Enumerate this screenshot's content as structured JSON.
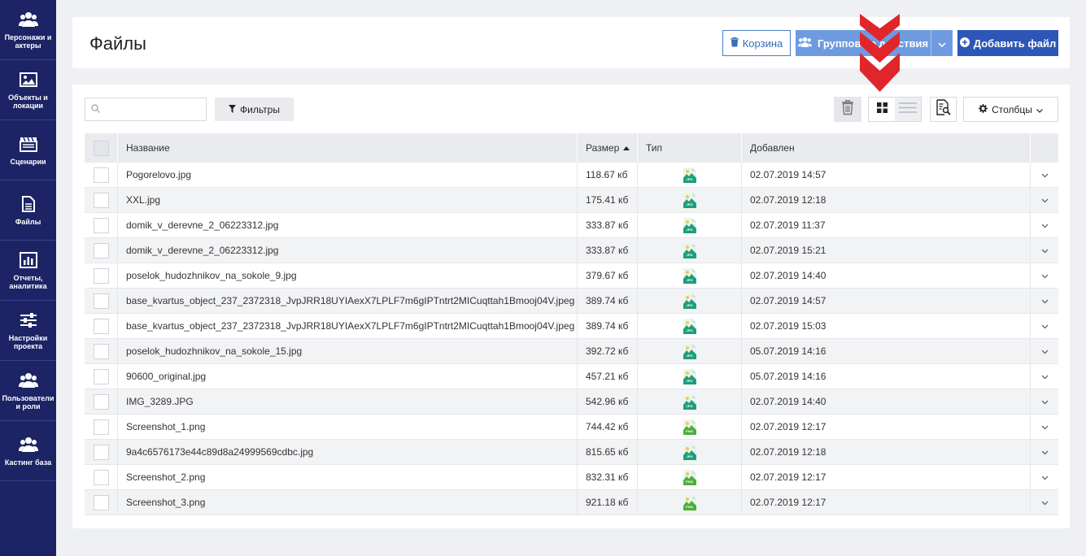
{
  "sidebar": {
    "items": [
      {
        "label": "Персонажи и актеры",
        "icon": "users-icon"
      },
      {
        "label": "Объекты и локации",
        "icon": "image-icon"
      },
      {
        "label": "Сценарии",
        "icon": "clapperboard-icon"
      },
      {
        "label": "Файлы",
        "icon": "file-icon"
      },
      {
        "label": "Отчеты, аналитика",
        "icon": "bar-chart-icon"
      },
      {
        "label": "Настройки проекта",
        "icon": "sliders-icon"
      },
      {
        "label": "Пользователи и роли",
        "icon": "users-icon"
      },
      {
        "label": "Кастинг база",
        "icon": "users-icon"
      }
    ]
  },
  "header": {
    "title": "Файлы",
    "trash_label": "Корзина",
    "group_label": "Групповые действия",
    "add_label": "Добавить файл"
  },
  "toolbar": {
    "search_placeholder": "",
    "filter_label": "Фильтры",
    "columns_label": "Столбцы"
  },
  "table": {
    "columns": {
      "name": "Название",
      "size": "Размер",
      "type": "Тип",
      "added": "Добавлен"
    },
    "rows": [
      {
        "name": "Pogorelovo.jpg",
        "size": "118.67 кб",
        "type": "JPG",
        "added": "02.07.2019 14:57"
      },
      {
        "name": "XXL.jpg",
        "size": "175.41 кб",
        "type": "JPG",
        "added": "02.07.2019 12:18"
      },
      {
        "name": "domik_v_derevne_2_06223312.jpg",
        "size": "333.87 кб",
        "type": "JPG",
        "added": "02.07.2019 11:37"
      },
      {
        "name": "domik_v_derevne_2_06223312.jpg",
        "size": "333.87 кб",
        "type": "JPG",
        "added": "02.07.2019 15:21"
      },
      {
        "name": "poselok_hudozhnikov_na_sokole_9.jpg",
        "size": "379.67 кб",
        "type": "JPG",
        "added": "02.07.2019 14:40"
      },
      {
        "name": "base_kvartus_object_237_2372318_JvpJRR18UYIAexX7LPLF7m6gIPTntrt2MICuqttah1Bmooj04V.jpeg",
        "size": "389.74 кб",
        "type": "JPG",
        "added": "02.07.2019 14:57"
      },
      {
        "name": "base_kvartus_object_237_2372318_JvpJRR18UYIAexX7LPLF7m6gIPTntrt2MICuqttah1Bmooj04V.jpeg",
        "size": "389.74 кб",
        "type": "JPG",
        "added": "02.07.2019 15:03"
      },
      {
        "name": "poselok_hudozhnikov_na_sokole_15.jpg",
        "size": "392.72 кб",
        "type": "JPG",
        "added": "05.07.2019 14:16"
      },
      {
        "name": "90600_original.jpg",
        "size": "457.21 кб",
        "type": "JPG",
        "added": "05.07.2019 14:16"
      },
      {
        "name": "IMG_3289.JPG",
        "size": "542.96 кб",
        "type": "JPG",
        "added": "02.07.2019 14:40"
      },
      {
        "name": "Screenshot_1.png",
        "size": "744.42 кб",
        "type": "PNG",
        "added": "02.07.2019 12:17"
      },
      {
        "name": "9a4c6576173e44c89d8a24999569cdbc.jpg",
        "size": "815.65 кб",
        "type": "JPG",
        "added": "02.07.2019 12:18"
      },
      {
        "name": "Screenshot_2.png",
        "size": "832.31 кб",
        "type": "PNG",
        "added": "02.07.2019 12:17"
      },
      {
        "name": "Screenshot_3.png",
        "size": "921.18 кб",
        "type": "PNG",
        "added": "02.07.2019 12:17"
      }
    ]
  },
  "colors": {
    "sidebar_bg": "#1c2466",
    "primary": "#2d56b8",
    "group_button": "#6e9be0",
    "arrow_red": "#e0262b",
    "jpg_icon": "#1f9e7a",
    "png_icon": "#4caf3b"
  }
}
